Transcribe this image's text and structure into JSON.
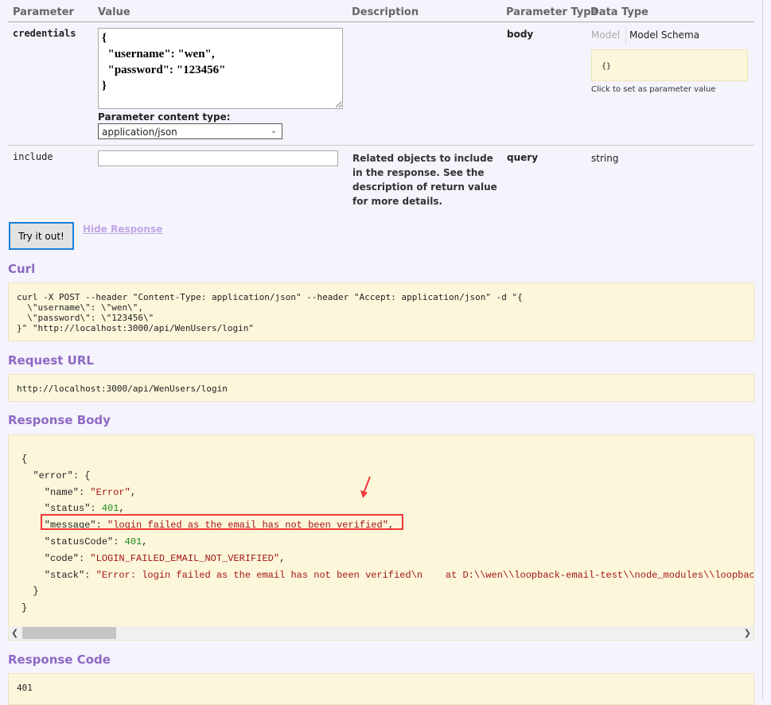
{
  "table": {
    "headers": [
      "Parameter",
      "Value",
      "Description",
      "Parameter Type",
      "Data Type"
    ],
    "rows": [
      {
        "name": "credentials",
        "value": "{\n  \"username\": \"wen\",\n  \"password\": \"123456\"\n}",
        "content_type_label": "Parameter content type:",
        "content_type": "application/json",
        "param_type": "body",
        "model_tab": "Model",
        "model_schema_tab": "Model Schema",
        "schema": "{}",
        "schema_hint": "Click to set as parameter value"
      },
      {
        "name": "include",
        "value": "",
        "description": "Related objects to include in the response. See the description of return value for more details.",
        "param_type": "query",
        "data_type": "string"
      }
    ]
  },
  "try_button": "Try it out!",
  "hide_response": "Hide Response",
  "curl": {
    "title": "Curl",
    "text": "curl -X POST --header \"Content-Type: application/json\" --header \"Accept: application/json\" -d \"{\n  \\\"username\\\": \\\"wen\\\",\n  \\\"password\\\": \\\"123456\\\"\n}\" \"http://localhost:3000/api/WenUsers/login\""
  },
  "request_url": {
    "title": "Request URL",
    "text": "http://localhost:3000/api/WenUsers/login"
  },
  "response_body": {
    "title": "Response Body",
    "name": "\"Error\"",
    "status": "401",
    "message": "\"login failed as the email has not been verified\"",
    "statusCode": "401",
    "code": "\"LOGIN_FAILED_EMAIL_NOT_VERIFIED\"",
    "stack": "\"Error: login failed as the email has not been verified\\n    at D:\\\\wen\\\\loopback-email-test\\\\node_modules\\\\loopback\\\\common"
  },
  "response_code": {
    "title": "Response Code",
    "text": "401"
  },
  "colors": {
    "accent": "#8e68c5",
    "code_bg": "#fcf6db",
    "highlight": "#f0373a"
  }
}
